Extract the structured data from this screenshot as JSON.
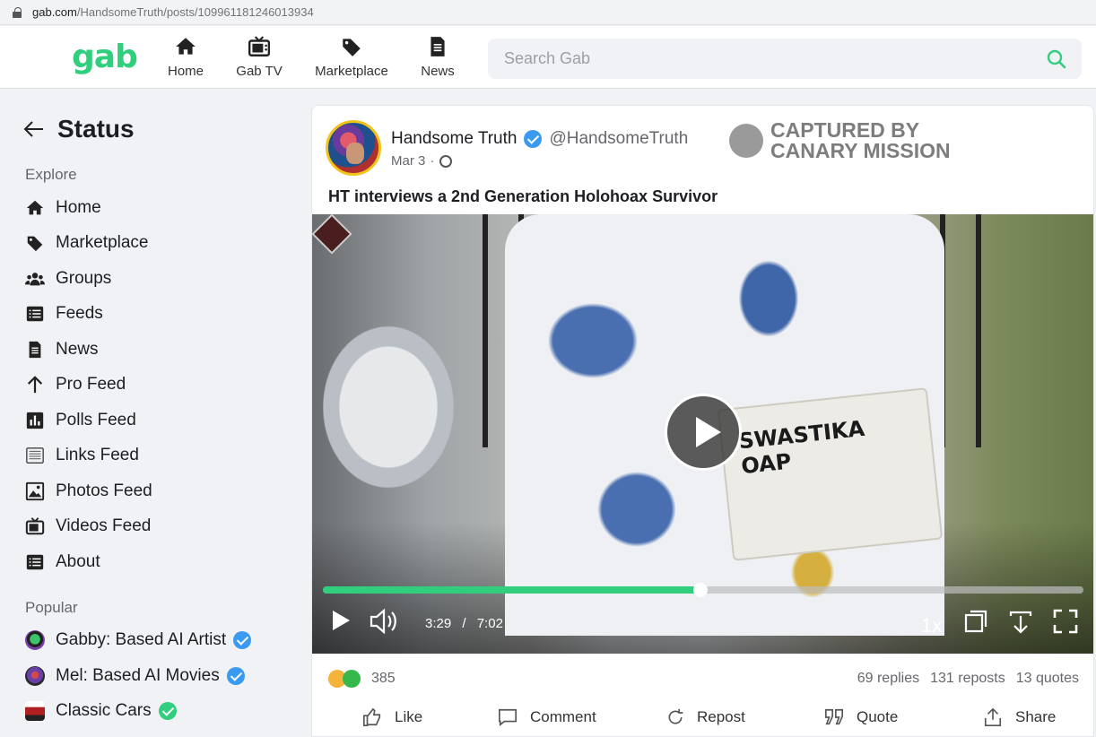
{
  "browser": {
    "url_host": "gab.com",
    "url_path": "/HandsomeTruth/posts/109961181246013934"
  },
  "nav": {
    "logo": "gab",
    "items": [
      {
        "label": "Home",
        "icon": "home-icon"
      },
      {
        "label": "Gab TV",
        "icon": "tv-icon"
      },
      {
        "label": "Marketplace",
        "icon": "tag-icon"
      },
      {
        "label": "News",
        "icon": "document-icon"
      }
    ],
    "search_placeholder": "Search Gab"
  },
  "sidebar": {
    "title": "Status",
    "explore_title": "Explore",
    "explore": [
      {
        "label": "Home",
        "icon": "home-icon"
      },
      {
        "label": "Marketplace",
        "icon": "tag-icon"
      },
      {
        "label": "Groups",
        "icon": "group-icon"
      },
      {
        "label": "Feeds",
        "icon": "list-icon"
      },
      {
        "label": "News",
        "icon": "document-icon"
      },
      {
        "label": "Pro Feed",
        "icon": "arrow-up-icon"
      },
      {
        "label": "Polls Feed",
        "icon": "bar-chart-icon"
      },
      {
        "label": "Links Feed",
        "icon": "links-icon"
      },
      {
        "label": "Photos Feed",
        "icon": "image-icon"
      },
      {
        "label": "Videos Feed",
        "icon": "tv-icon"
      },
      {
        "label": "About",
        "icon": "list-icon"
      }
    ],
    "popular_title": "Popular",
    "popular": [
      {
        "label": "Gabby: Based AI Artist",
        "verified": "blue"
      },
      {
        "label": "Mel: Based AI Movies",
        "verified": "blue"
      },
      {
        "label": "Classic Cars",
        "verified": "green"
      }
    ]
  },
  "post": {
    "author_name": "Handsome Truth",
    "author_handle": "@HandsomeTruth",
    "date": "Mar 3",
    "separator": "·",
    "watermark_line1": "CAPTURED BY",
    "watermark_line2": "CANARY MISSION",
    "text": "HT interviews a 2nd Generation Holohoax Survivor",
    "video": {
      "soap_line1": "SWASTIKA",
      "soap_line2": "OAP",
      "current_time": "3:29",
      "time_separator": "/",
      "duration": "7:02",
      "progress_fraction": 0.4964,
      "speed": "1x"
    },
    "reaction_count": "385",
    "replies": "69 replies",
    "reposts": "131 reposts",
    "quotes": "13 quotes",
    "actions": {
      "like": "Like",
      "comment": "Comment",
      "repost": "Repost",
      "quote": "Quote",
      "share": "Share"
    }
  },
  "colors": {
    "brand": "#30ce7d",
    "verified_blue": "#3a9af1"
  }
}
